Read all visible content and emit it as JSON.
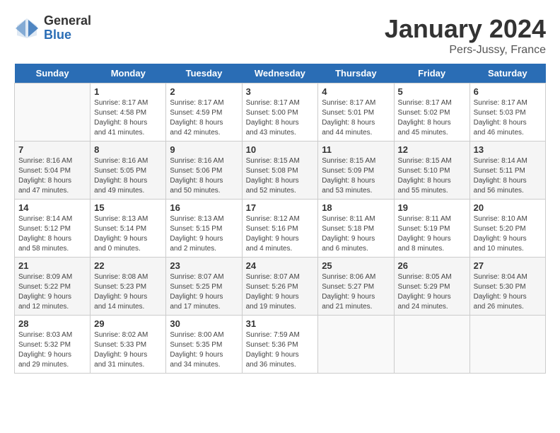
{
  "logo": {
    "general": "General",
    "blue": "Blue"
  },
  "header": {
    "title": "January 2024",
    "subtitle": "Pers-Jussy, France"
  },
  "weekdays": [
    "Sunday",
    "Monday",
    "Tuesday",
    "Wednesday",
    "Thursday",
    "Friday",
    "Saturday"
  ],
  "weeks": [
    {
      "shade": "light",
      "days": [
        {
          "number": "",
          "info": "",
          "empty": true
        },
        {
          "number": "1",
          "info": "Sunrise: 8:17 AM\nSunset: 4:58 PM\nDaylight: 8 hours\nand 41 minutes."
        },
        {
          "number": "2",
          "info": "Sunrise: 8:17 AM\nSunset: 4:59 PM\nDaylight: 8 hours\nand 42 minutes."
        },
        {
          "number": "3",
          "info": "Sunrise: 8:17 AM\nSunset: 5:00 PM\nDaylight: 8 hours\nand 43 minutes."
        },
        {
          "number": "4",
          "info": "Sunrise: 8:17 AM\nSunset: 5:01 PM\nDaylight: 8 hours\nand 44 minutes."
        },
        {
          "number": "5",
          "info": "Sunrise: 8:17 AM\nSunset: 5:02 PM\nDaylight: 8 hours\nand 45 minutes."
        },
        {
          "number": "6",
          "info": "Sunrise: 8:17 AM\nSunset: 5:03 PM\nDaylight: 8 hours\nand 46 minutes."
        }
      ]
    },
    {
      "shade": "dark",
      "days": [
        {
          "number": "7",
          "info": "Sunrise: 8:16 AM\nSunset: 5:04 PM\nDaylight: 8 hours\nand 47 minutes."
        },
        {
          "number": "8",
          "info": "Sunrise: 8:16 AM\nSunset: 5:05 PM\nDaylight: 8 hours\nand 49 minutes."
        },
        {
          "number": "9",
          "info": "Sunrise: 8:16 AM\nSunset: 5:06 PM\nDaylight: 8 hours\nand 50 minutes."
        },
        {
          "number": "10",
          "info": "Sunrise: 8:15 AM\nSunset: 5:08 PM\nDaylight: 8 hours\nand 52 minutes."
        },
        {
          "number": "11",
          "info": "Sunrise: 8:15 AM\nSunset: 5:09 PM\nDaylight: 8 hours\nand 53 minutes."
        },
        {
          "number": "12",
          "info": "Sunrise: 8:15 AM\nSunset: 5:10 PM\nDaylight: 8 hours\nand 55 minutes."
        },
        {
          "number": "13",
          "info": "Sunrise: 8:14 AM\nSunset: 5:11 PM\nDaylight: 8 hours\nand 56 minutes."
        }
      ]
    },
    {
      "shade": "light",
      "days": [
        {
          "number": "14",
          "info": "Sunrise: 8:14 AM\nSunset: 5:12 PM\nDaylight: 8 hours\nand 58 minutes."
        },
        {
          "number": "15",
          "info": "Sunrise: 8:13 AM\nSunset: 5:14 PM\nDaylight: 9 hours\nand 0 minutes."
        },
        {
          "number": "16",
          "info": "Sunrise: 8:13 AM\nSunset: 5:15 PM\nDaylight: 9 hours\nand 2 minutes."
        },
        {
          "number": "17",
          "info": "Sunrise: 8:12 AM\nSunset: 5:16 PM\nDaylight: 9 hours\nand 4 minutes."
        },
        {
          "number": "18",
          "info": "Sunrise: 8:11 AM\nSunset: 5:18 PM\nDaylight: 9 hours\nand 6 minutes."
        },
        {
          "number": "19",
          "info": "Sunrise: 8:11 AM\nSunset: 5:19 PM\nDaylight: 9 hours\nand 8 minutes."
        },
        {
          "number": "20",
          "info": "Sunrise: 8:10 AM\nSunset: 5:20 PM\nDaylight: 9 hours\nand 10 minutes."
        }
      ]
    },
    {
      "shade": "dark",
      "days": [
        {
          "number": "21",
          "info": "Sunrise: 8:09 AM\nSunset: 5:22 PM\nDaylight: 9 hours\nand 12 minutes."
        },
        {
          "number": "22",
          "info": "Sunrise: 8:08 AM\nSunset: 5:23 PM\nDaylight: 9 hours\nand 14 minutes."
        },
        {
          "number": "23",
          "info": "Sunrise: 8:07 AM\nSunset: 5:25 PM\nDaylight: 9 hours\nand 17 minutes."
        },
        {
          "number": "24",
          "info": "Sunrise: 8:07 AM\nSunset: 5:26 PM\nDaylight: 9 hours\nand 19 minutes."
        },
        {
          "number": "25",
          "info": "Sunrise: 8:06 AM\nSunset: 5:27 PM\nDaylight: 9 hours\nand 21 minutes."
        },
        {
          "number": "26",
          "info": "Sunrise: 8:05 AM\nSunset: 5:29 PM\nDaylight: 9 hours\nand 24 minutes."
        },
        {
          "number": "27",
          "info": "Sunrise: 8:04 AM\nSunset: 5:30 PM\nDaylight: 9 hours\nand 26 minutes."
        }
      ]
    },
    {
      "shade": "light",
      "days": [
        {
          "number": "28",
          "info": "Sunrise: 8:03 AM\nSunset: 5:32 PM\nDaylight: 9 hours\nand 29 minutes."
        },
        {
          "number": "29",
          "info": "Sunrise: 8:02 AM\nSunset: 5:33 PM\nDaylight: 9 hours\nand 31 minutes."
        },
        {
          "number": "30",
          "info": "Sunrise: 8:00 AM\nSunset: 5:35 PM\nDaylight: 9 hours\nand 34 minutes."
        },
        {
          "number": "31",
          "info": "Sunrise: 7:59 AM\nSunset: 5:36 PM\nDaylight: 9 hours\nand 36 minutes."
        },
        {
          "number": "",
          "info": "",
          "empty": true
        },
        {
          "number": "",
          "info": "",
          "empty": true
        },
        {
          "number": "",
          "info": "",
          "empty": true
        }
      ]
    }
  ]
}
